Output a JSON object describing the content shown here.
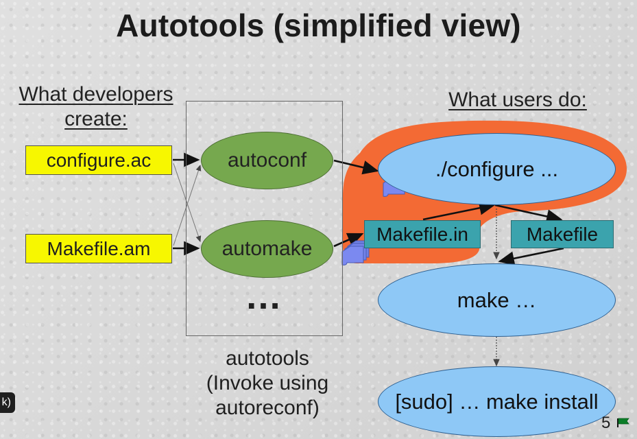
{
  "slide": {
    "title": "Autotools (simplified view)",
    "left_heading_line1": "What developers",
    "left_heading_line2": "create:",
    "right_heading": "What users do:",
    "page_number": "5",
    "overlay_fragment": "k)"
  },
  "developer_files": [
    "configure.ac",
    "Makefile.am"
  ],
  "tools": [
    "autoconf",
    "automake"
  ],
  "tools_ellipsis": "…",
  "autotools_caption": {
    "line1": "autotools",
    "line2": "(Invoke using",
    "line3": "autoreconf)"
  },
  "generated_files": [
    "Makefile.in",
    "Makefile"
  ],
  "user_steps": [
    "./configure ...",
    "make …",
    "[sudo] … make install"
  ],
  "colors": {
    "yellow_box": "#f7f700",
    "green_oval": "#76a84e",
    "blue_oval": "#8ec8f6",
    "cyan_box": "#3ba3ad",
    "orange_region": "#f36a34",
    "icon_blue": "#6f7fe1",
    "flag_green": "#0b7d28"
  }
}
